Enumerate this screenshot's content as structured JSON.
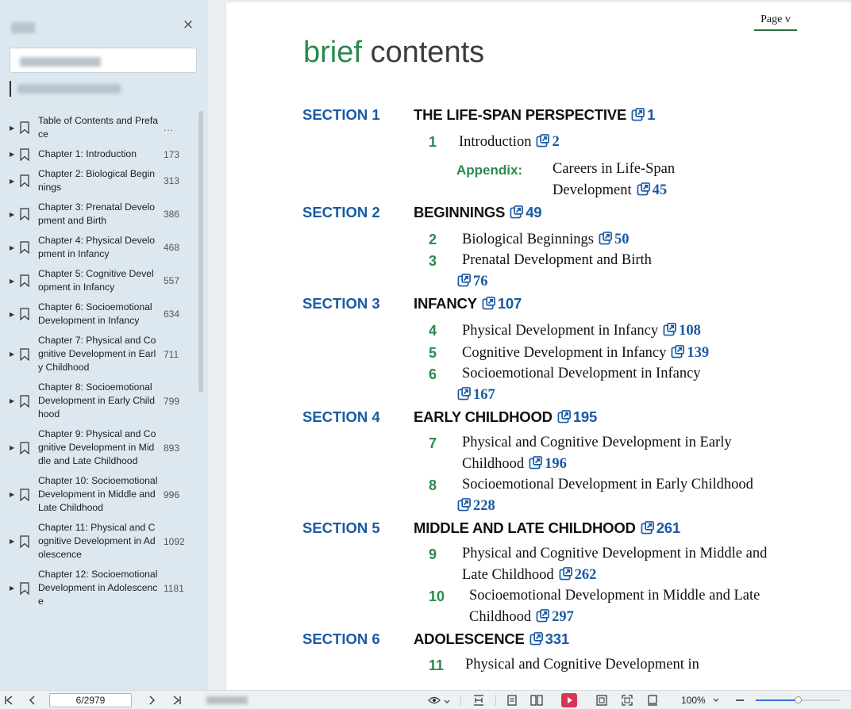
{
  "sidebar": {
    "close_glyph": "×",
    "items": [
      {
        "label": "Table of Contents and Preface",
        "page": "..."
      },
      {
        "label": "Chapter 1: Introduction",
        "page": "173"
      },
      {
        "label": "Chapter 2: Biological Beginnings",
        "page": "313"
      },
      {
        "label": "Chapter 3: Prenatal Development and Birth",
        "page": "386"
      },
      {
        "label": "Chapter 4: Physical Development in Infancy",
        "page": "468"
      },
      {
        "label": "Chapter 5: Cognitive Development in Infancy",
        "page": "557"
      },
      {
        "label": "Chapter 6: Socioemotional Development in Infancy",
        "page": "634"
      },
      {
        "label": "Chapter 7: Physical and Cognitive Development in Early Childhood",
        "page": "711"
      },
      {
        "label": "Chapter 8: Socioemotional Development in Early Childhood",
        "page": "799"
      },
      {
        "label": "Chapter 9: Physical and Cognitive Development in Middle and Late Childhood",
        "page": "893"
      },
      {
        "label": "Chapter 10: Socioemotional Development in Middle and Late Childhood",
        "page": "996"
      },
      {
        "label": "Chapter 11: Physical and Cognitive Development in Adolescence",
        "page": "1092"
      },
      {
        "label": "Chapter 12: Socioemotional Development in Adolescence",
        "page": "1181"
      }
    ]
  },
  "document": {
    "page_label": "Page v",
    "title_word1": "brief",
    "title_word2": "contents",
    "sections": [
      {
        "label": "SECTION 1",
        "title": "THE LIFE-SPAN PERSPECTIVE",
        "page": "1"
      },
      {
        "label": "SECTION 2",
        "title": "BEGINNINGS",
        "page": "49"
      },
      {
        "label": "SECTION 3",
        "title": "INFANCY",
        "page": "107"
      },
      {
        "label": "SECTION 4",
        "title": "EARLY CHILDHOOD",
        "page": "195"
      },
      {
        "label": "SECTION 5",
        "title": "MIDDLE AND LATE CHILDHOOD",
        "page": "261"
      },
      {
        "label": "SECTION 6",
        "title": "ADOLESCENCE",
        "page": "331"
      }
    ],
    "chapters": [
      {
        "num": "1",
        "lines": [
          "Introduction"
        ],
        "page": "2"
      },
      {
        "num": "2",
        "lines": [
          "Biological Beginnings"
        ],
        "page": "50"
      },
      {
        "num": "3",
        "lines": [
          "Prenatal Development and Birth",
          ""
        ],
        "page": "76"
      },
      {
        "num": "4",
        "lines": [
          "Physical Development in Infancy"
        ],
        "page": "108"
      },
      {
        "num": "5",
        "lines": [
          "Cognitive Development in Infancy"
        ],
        "page": "139"
      },
      {
        "num": "6",
        "lines": [
          "Socioemotional Development in Infancy",
          ""
        ],
        "page": "167"
      },
      {
        "num": "7",
        "lines": [
          "Physical and Cognitive Development in Early",
          "Childhood"
        ],
        "page": "196"
      },
      {
        "num": "8",
        "lines": [
          "Socioemotional Development in Early Childhood",
          ""
        ],
        "page": "228"
      },
      {
        "num": "9",
        "lines": [
          "Physical and Cognitive Development in Middle and",
          "Late Childhood"
        ],
        "page": "262"
      },
      {
        "num": "10",
        "lines": [
          "Socioemotional Development in Middle and Late",
          "Childhood"
        ],
        "page": "297"
      },
      {
        "num": "11",
        "lines": [
          "Physical and Cognitive Development in"
        ],
        "page": ""
      }
    ],
    "appendix": {
      "label": "Appendix:",
      "lines": [
        "Careers in Life-Span",
        "Development"
      ],
      "page": "45"
    }
  },
  "statusbar": {
    "page_indicator": "6/2979",
    "zoom": "100%",
    "zoom_level": 0.5,
    "accent_color": "#d93556"
  },
  "colors": {
    "section_blue": "#1a5aa3",
    "title_green": "#2b8a4d",
    "sidebar_bg": "#dde7ef"
  }
}
